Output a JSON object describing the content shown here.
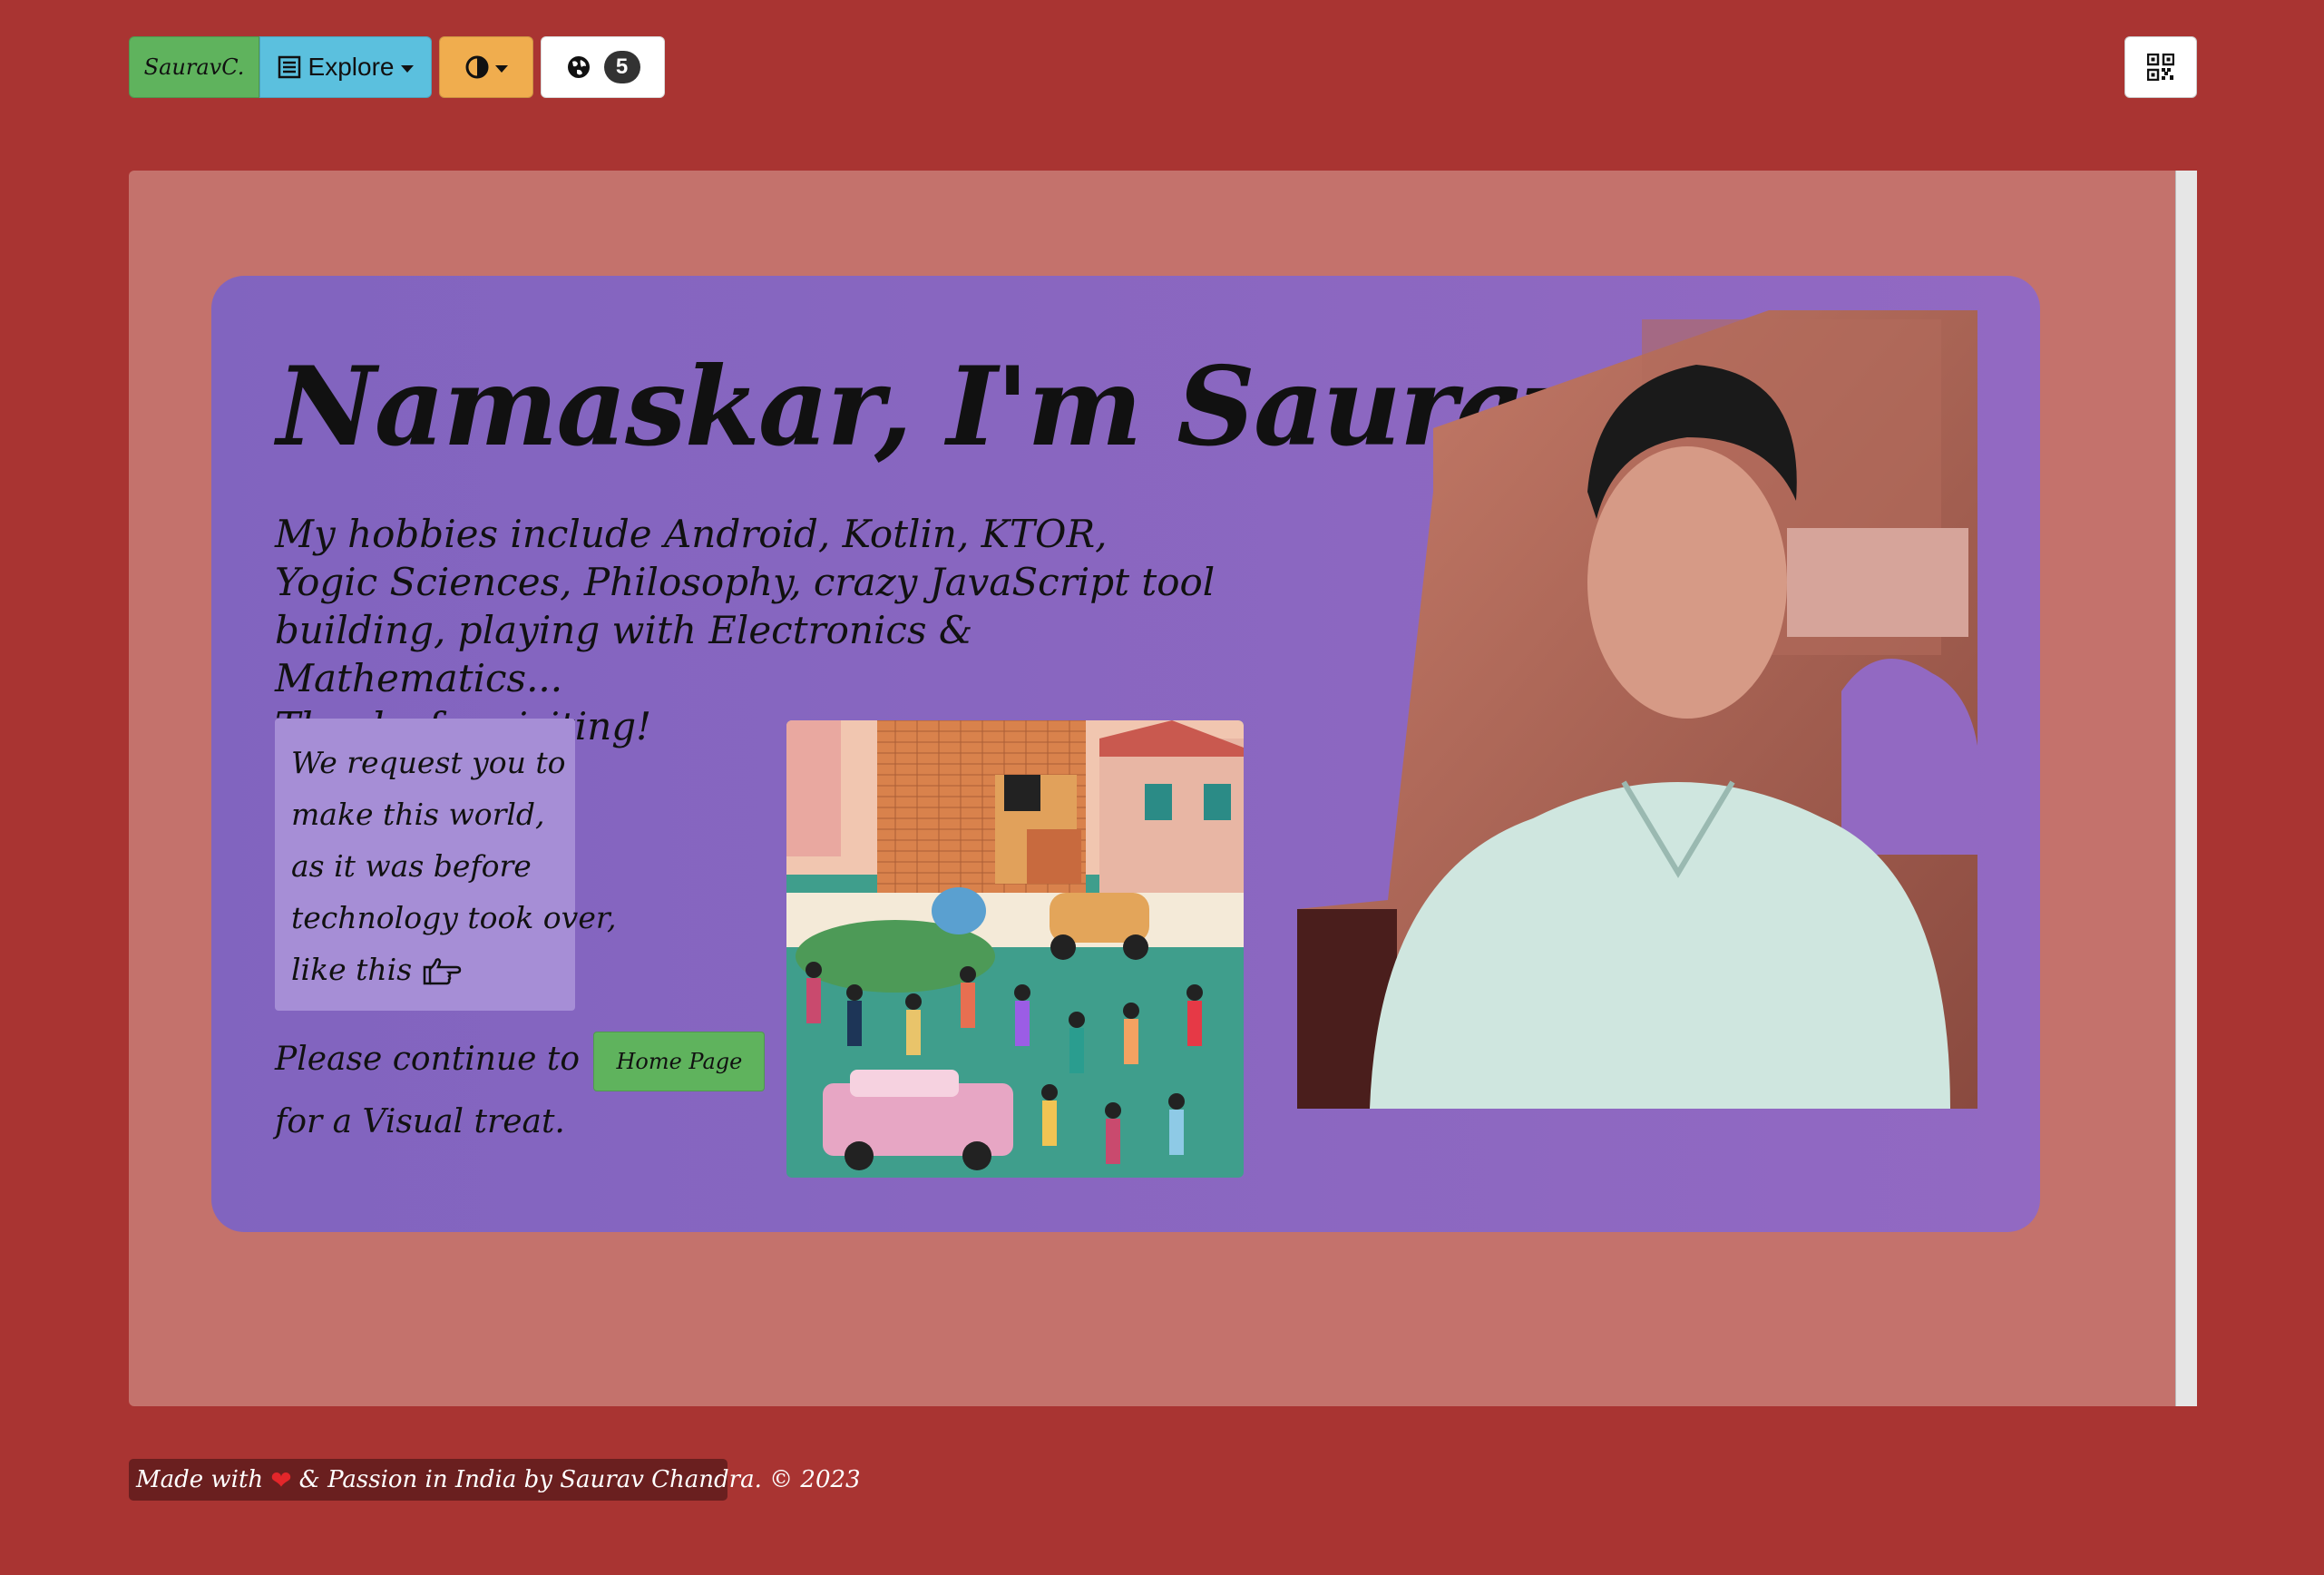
{
  "nav": {
    "brand_label": "SauravC.",
    "explore_label": "Explore",
    "language_count": "5",
    "icons": {
      "explore": "list-icon",
      "theme": "contrast-icon",
      "language": "globe-icon",
      "qr": "qr-code-icon"
    }
  },
  "hero": {
    "greeting": "Namaskar, I'm Saurav",
    "hobbies": "My hobbies include Android, Kotlin, KTOR, Yogic Sciences, Philosophy, crazy JavaScript tool building, playing with Electronics & Mathematics...",
    "thanks": "Thanks for visiting!",
    "quote_lines": [
      "We request you to",
      "make this world,",
      "as it was before",
      "technology took over,",
      "like this"
    ],
    "continue_before": "Please continue to",
    "home_button": "Home Page",
    "continue_after": "for a Visual treat."
  },
  "footer": {
    "text_before": "Made with",
    "text_after": "& Passion in India by Saurav Chandra. © 2023"
  },
  "colors": {
    "page_bg": "#a93432",
    "panel_bg": "#c4726c",
    "card_bg": "#8164bf",
    "quote_bg": "#a68ed6",
    "brand_green": "#5fb35d",
    "explore_blue": "#5bc0de",
    "theme_orange": "#f0ad4e",
    "footer_bg": "#6a1f1f",
    "heart": "#e3262a"
  }
}
